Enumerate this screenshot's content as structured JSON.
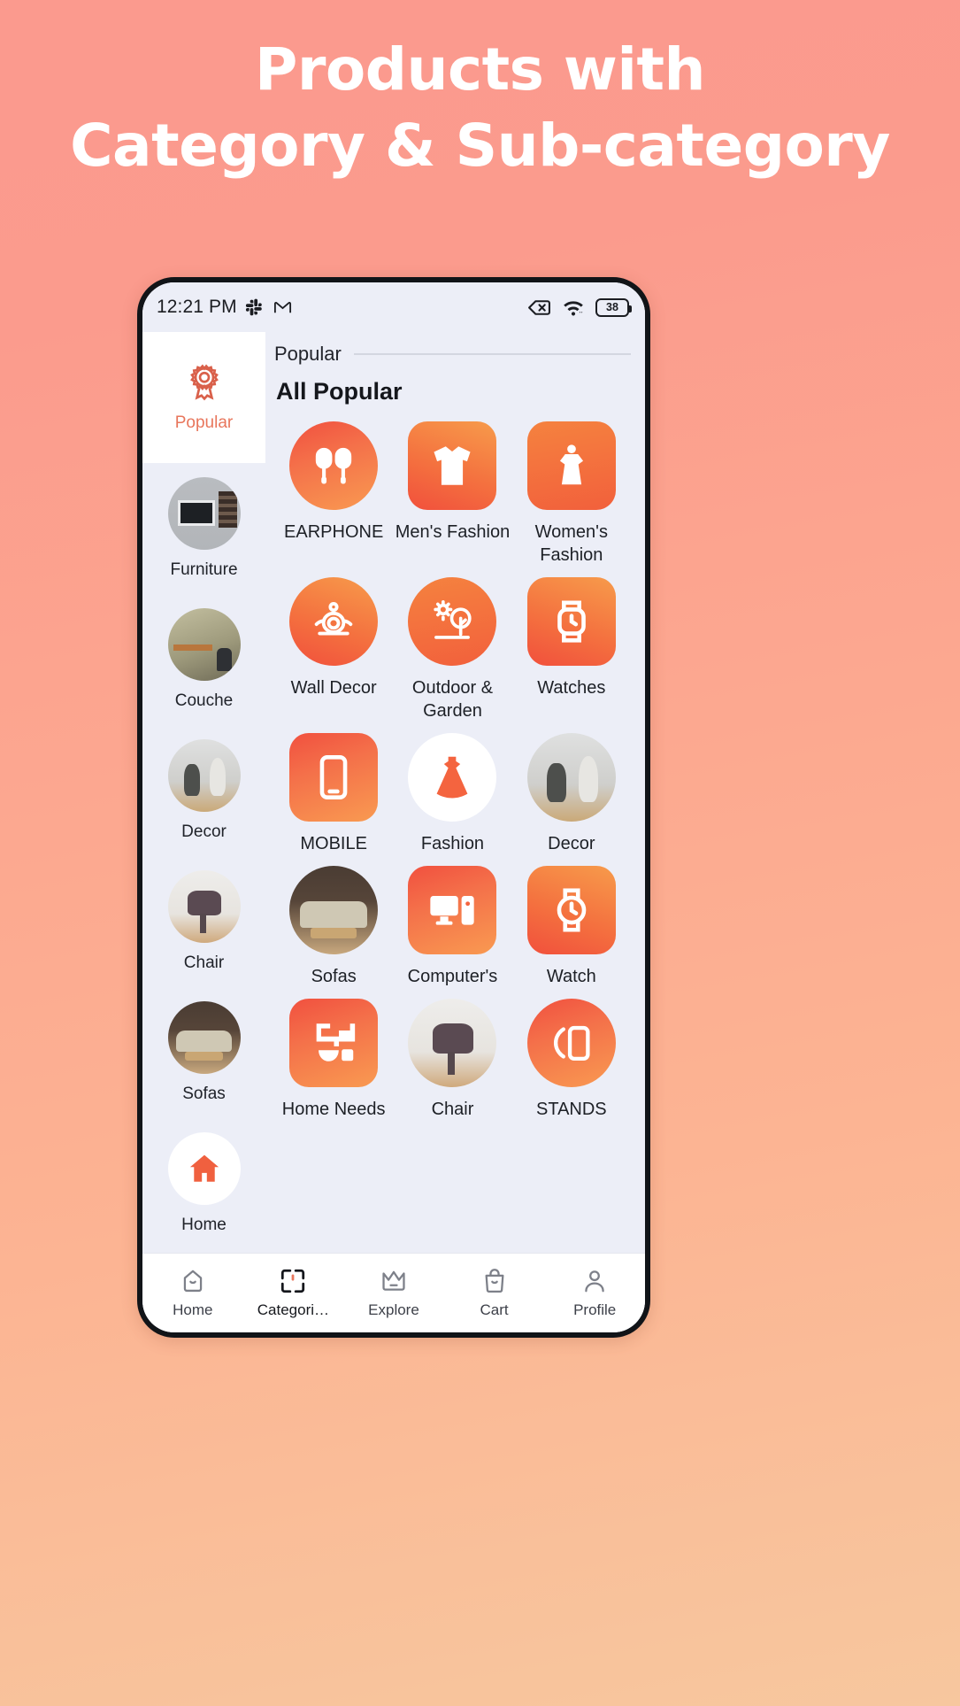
{
  "hero": {
    "line1": "Products with",
    "line2": "Category & Sub-category"
  },
  "colors": {
    "page_bg_top": "#fb9a8e",
    "page_bg_bottom": "#f7c79e",
    "accent": "#e8765c",
    "app_bg": "#eceef7",
    "tile_gradient_start": "#f1503f",
    "tile_gradient_end": "#f99a51"
  },
  "statusbar": {
    "time": "12:21 PM",
    "left_icons": [
      "slack-icon",
      "gmail-icon"
    ],
    "right_icons": [
      "no-sim-icon",
      "wifi-icon"
    ],
    "battery_level": "38"
  },
  "sidebar": {
    "items": [
      {
        "label": "Popular",
        "icon": "award-badge-icon",
        "active": true,
        "thumb": "badge"
      },
      {
        "label": "Furniture",
        "icon": "",
        "active": false,
        "thumb": "th-furniture"
      },
      {
        "label": "Couche",
        "icon": "",
        "active": false,
        "thumb": "th-couche"
      },
      {
        "label": "Decor",
        "icon": "",
        "active": false,
        "thumb": "th-decor"
      },
      {
        "label": "Chair",
        "icon": "",
        "active": false,
        "thumb": "th-chair"
      },
      {
        "label": "Sofas",
        "icon": "",
        "active": false,
        "thumb": "th-sofas"
      },
      {
        "label": "Home",
        "icon": "home-icon",
        "active": false,
        "thumb": "th-home"
      }
    ]
  },
  "main": {
    "breadcrumb": "Popular",
    "section_title": "All Popular",
    "grid": [
      {
        "label": "EARPHONE",
        "icon": "earphone-icon",
        "shape": "circle",
        "art": "g-warm"
      },
      {
        "label": "Men's Fashion",
        "icon": "shirt-icon",
        "shape": "rounded",
        "art": "g-warm2"
      },
      {
        "label": "Women's Fashion",
        "icon": "dress-icon",
        "shape": "rounded",
        "art": "g-warm3"
      },
      {
        "label": "Wall Decor",
        "icon": "lotus-icon",
        "shape": "circle",
        "art": "g-warm2"
      },
      {
        "label": "Outdoor & Garden",
        "icon": "tree-sun-icon",
        "shape": "circle",
        "art": "g-warm3"
      },
      {
        "label": "Watches",
        "icon": "watch-icon",
        "shape": "rounded",
        "art": "g-warm2"
      },
      {
        "label": "MOBILE",
        "icon": "mobile-icon",
        "shape": "rounded",
        "art": "g-warm"
      },
      {
        "label": "Fashion",
        "icon": "dress-flare-icon",
        "shape": "circle",
        "art": "g-white"
      },
      {
        "label": "Decor",
        "icon": "photo-decor",
        "shape": "circle",
        "art": "ph-decor"
      },
      {
        "label": "Sofas",
        "icon": "photo-sofas",
        "shape": "circle",
        "art": "ph-sofas"
      },
      {
        "label": "Computer's",
        "icon": "computer-icon",
        "shape": "rounded",
        "art": "g-warm"
      },
      {
        "label": "Watch",
        "icon": "watch-round-icon",
        "shape": "rounded",
        "art": "g-warm2"
      },
      {
        "label": "Home Needs",
        "icon": "mixer-icon",
        "shape": "rounded",
        "art": "g-warm"
      },
      {
        "label": "Chair",
        "icon": "photo-chair",
        "shape": "circle",
        "art": "ph-chair"
      },
      {
        "label": "STANDS",
        "icon": "stand-icon",
        "shape": "circle",
        "art": "g-warm"
      }
    ]
  },
  "bottomnav": {
    "items": [
      {
        "label": "Home",
        "icon": "home-outline-icon",
        "active": false
      },
      {
        "label": "Categori…",
        "icon": "categories-icon",
        "active": true
      },
      {
        "label": "Explore",
        "icon": "crown-icon",
        "active": false
      },
      {
        "label": "Cart",
        "icon": "shopping-bag-icon",
        "active": false
      },
      {
        "label": "Profile",
        "icon": "person-icon",
        "active": false
      }
    ]
  }
}
